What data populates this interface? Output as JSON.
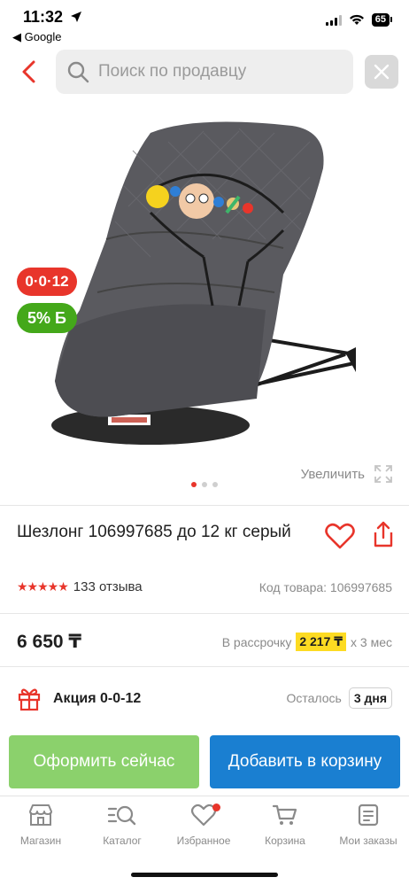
{
  "status_bar": {
    "time": "11:32",
    "back_app": "◀ Google",
    "battery": "65"
  },
  "search": {
    "placeholder": "Поиск по продавцу"
  },
  "gallery": {
    "badge_installment": "0·0·12",
    "badge_bonus": "5% Б",
    "zoom_label": "Увеличить",
    "image_count": 3,
    "active_image": 1
  },
  "product": {
    "title": "Шезлонг 106997685 до 12 кг серый",
    "rating_stars": 5,
    "reviews": "133 отзыва",
    "sku": "Код товара: 106997685",
    "price": "6 650 ₸",
    "installment_prefix": "В рассрочку",
    "installment_amount": "2 217 ₸",
    "installment_suffix": "x 3 мес"
  },
  "promo": {
    "label": "Акция 0-0-12",
    "remaining_label": "Осталось",
    "remaining_value": "3 дня"
  },
  "actions": {
    "buy_now": "Оформить сейчас",
    "add_to_cart": "Добавить в корзину"
  },
  "tabs": [
    {
      "label": "Магазин",
      "icon": "store-icon"
    },
    {
      "label": "Каталог",
      "icon": "catalog-search-icon"
    },
    {
      "label": "Избранное",
      "icon": "heart-icon"
    },
    {
      "label": "Корзина",
      "icon": "cart-icon"
    },
    {
      "label": "Мои заказы",
      "icon": "orders-icon"
    }
  ],
  "colors": {
    "accent_red": "#e8352b",
    "buy_green": "#8bd16c",
    "cart_blue": "#1a7fd1",
    "installment_yellow": "#fddb22",
    "bonus_green": "#44a81a"
  }
}
